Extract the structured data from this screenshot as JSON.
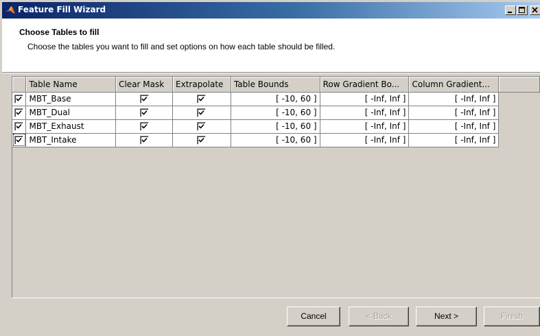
{
  "window": {
    "title": "Feature Fill Wizard",
    "accent_color": "#0a246a",
    "controls": {
      "minimize_icon": "minimize-icon",
      "maximize_icon": "maximize-icon",
      "close_icon": "close-icon"
    }
  },
  "header": {
    "title": "Choose Tables to fill",
    "subtitle": "Choose the tables you want to fill and set options on how each table should be filled."
  },
  "table": {
    "columns": [
      "",
      "Table Name",
      "Clear Mask",
      "Extrapolate",
      "Table Bounds",
      "Row Gradient Bo...",
      "Column Gradient..."
    ],
    "rows": [
      {
        "selected": true,
        "name": "MBT_Base",
        "clear_mask": true,
        "extrapolate": true,
        "bounds": "[ -10, 60 ]",
        "row_gradient": "[ -Inf, Inf ]",
        "col_gradient": "[ -Inf, Inf ]"
      },
      {
        "selected": true,
        "name": "MBT_Dual",
        "clear_mask": true,
        "extrapolate": true,
        "bounds": "[ -10, 60 ]",
        "row_gradient": "[ -Inf, Inf ]",
        "col_gradient": "[ -Inf, Inf ]"
      },
      {
        "selected": true,
        "name": "MBT_Exhaust",
        "clear_mask": true,
        "extrapolate": true,
        "bounds": "[ -10, 60 ]",
        "row_gradient": "[ -Inf, Inf ]",
        "col_gradient": "[ -Inf, Inf ]"
      },
      {
        "selected": true,
        "name": "MBT_Intake",
        "clear_mask": true,
        "extrapolate": true,
        "bounds": "[ -10, 60 ]",
        "row_gradient": "[ -Inf, Inf ]",
        "col_gradient": "[ -Inf, Inf ]"
      }
    ]
  },
  "buttons": {
    "cancel": "Cancel",
    "back": "< Back",
    "next": "Next >",
    "finish": "Finish"
  }
}
